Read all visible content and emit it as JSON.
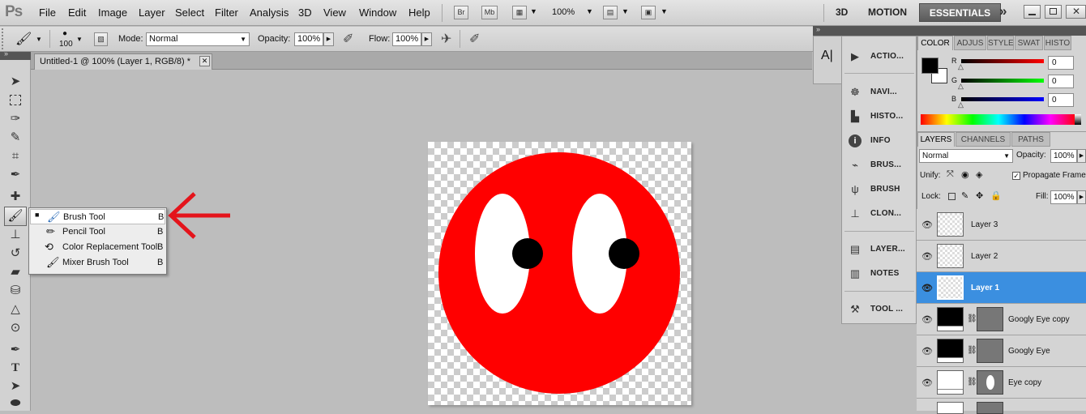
{
  "app": {
    "logo": "Ps"
  },
  "menu": [
    "File",
    "Edit",
    "Image",
    "Layer",
    "Select",
    "Filter",
    "Analysis",
    "3D",
    "View",
    "Window",
    "Help"
  ],
  "appbar": {
    "br": "Br",
    "mb": "Mb",
    "zoom": "100%",
    "zoom_arrow": "▼"
  },
  "workspaces": {
    "w1": "3D",
    "w2": "MOTION",
    "active": "ESSENTIALS",
    "more": "»"
  },
  "options": {
    "brush_size": "100",
    "mode_label": "Mode:",
    "mode_value": "Normal",
    "opacity_label": "Opacity:",
    "opacity_value": "100%",
    "flow_label": "Flow:",
    "flow_value": "100%"
  },
  "document": {
    "tab_title": "Untitled-1 @ 100% (Layer 1, RGB/8) *",
    "close": "✕"
  },
  "flyout": [
    {
      "label": "Brush Tool",
      "key": "B",
      "active": true
    },
    {
      "label": "Pencil Tool",
      "key": "B",
      "active": false
    },
    {
      "label": "Color Replacement Tool",
      "key": "B",
      "active": false
    },
    {
      "label": "Mixer Brush Tool",
      "key": "B",
      "active": false
    }
  ],
  "annotation": {
    "arrow_color": "#e4141b"
  },
  "artwork": {
    "face_color": "#ff0000",
    "eye_white": "#ffffff",
    "pupil": "#000000"
  },
  "panel_strip": [
    {
      "label": "ACTIO...",
      "icon": "play-icon"
    },
    {
      "label": "NAVI...",
      "icon": "navigator-icon"
    },
    {
      "label": "HISTO...",
      "icon": "histogram-icon"
    },
    {
      "label": "INFO",
      "icon": "info-icon"
    },
    {
      "label": "BRUS...",
      "icon": "brush-presets-icon"
    },
    {
      "label": "BRUSH",
      "icon": "brush-icon"
    },
    {
      "label": "CLON...",
      "icon": "clone-source-icon"
    },
    {
      "label": "LAYER...",
      "icon": "layer-comps-icon"
    },
    {
      "label": "NOTES",
      "icon": "notes-icon"
    },
    {
      "label": "TOOL ...",
      "icon": "tool-presets-icon"
    }
  ],
  "color_panel": {
    "tabs": [
      "COLOR",
      "ADJUS",
      "STYLE",
      "SWAT",
      "HISTO"
    ],
    "r_label": "R",
    "g_label": "G",
    "b_label": "B",
    "r": "0",
    "g": "0",
    "b": "0"
  },
  "layers_panel": {
    "tabs": [
      "LAYERS",
      "CHANNELS",
      "PATHS"
    ],
    "blend": "Normal",
    "opacity_label": "Opacity:",
    "opacity": "100%",
    "unify_label": "Unify:",
    "propagate_label": "Propagate Frame",
    "lock_label": "Lock:",
    "fill_label": "Fill:",
    "fill": "100%",
    "layers": [
      {
        "name": "Layer 3",
        "selected": false
      },
      {
        "name": "Layer 2",
        "selected": false
      },
      {
        "name": "Layer 1",
        "selected": true
      },
      {
        "name": "Googly Eye copy",
        "selected": false
      },
      {
        "name": "Googly Eye",
        "selected": false
      },
      {
        "name": "Eye copy",
        "selected": false
      }
    ]
  }
}
